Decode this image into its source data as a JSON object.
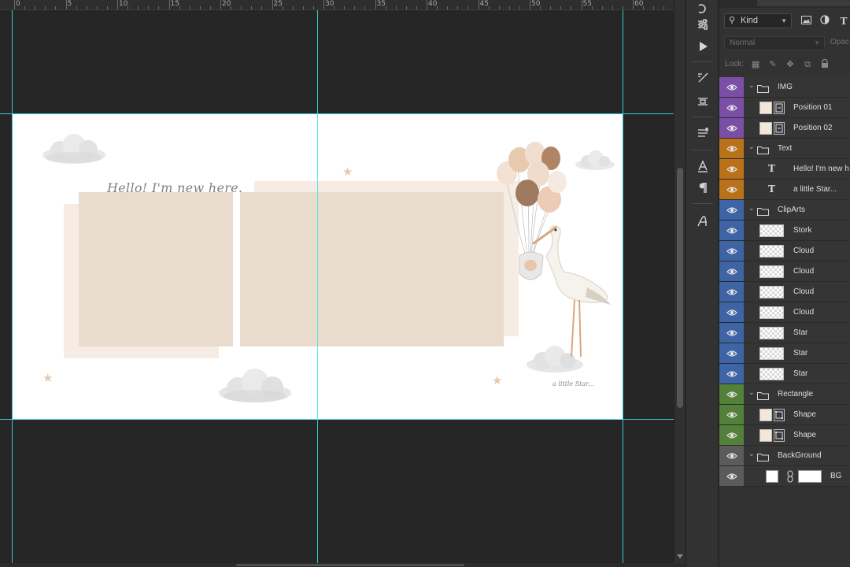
{
  "ruler": {
    "labels": [
      "0",
      "5",
      "10",
      "15",
      "20",
      "25",
      "30",
      "35",
      "40",
      "45",
      "50",
      "55",
      "60"
    ]
  },
  "canvas": {
    "hello_text": "Hello! I'm new here.",
    "little_star_text": "a little Star..."
  },
  "layers_panel": {
    "filter": {
      "kind_label": "Kind"
    },
    "blend_mode": "Normal",
    "opacity_label": "Opac",
    "lock_label": "Lock:",
    "layers": [
      {
        "name": "IMG",
        "kind": "group",
        "color": "#7b4fa6"
      },
      {
        "name": "Position 01",
        "kind": "smart",
        "color": "#7b4fa6"
      },
      {
        "name": "Position 02",
        "kind": "smart",
        "color": "#7b4fa6"
      },
      {
        "name": "Text",
        "kind": "group",
        "color": "#b9711a"
      },
      {
        "name": "Hello! I'm new h",
        "kind": "text",
        "color": "#b9711a"
      },
      {
        "name": "a little Star...",
        "kind": "text",
        "color": "#b9711a"
      },
      {
        "name": "ClipArts",
        "kind": "group",
        "color": "#3e64a6"
      },
      {
        "name": "Stork",
        "kind": "pixel",
        "color": "#3e64a6"
      },
      {
        "name": "Cloud",
        "kind": "pixel",
        "color": "#3e64a6"
      },
      {
        "name": "Cloud",
        "kind": "pixel",
        "color": "#3e64a6"
      },
      {
        "name": "Cloud",
        "kind": "pixel",
        "color": "#3e64a6"
      },
      {
        "name": "Cloud",
        "kind": "pixel",
        "color": "#3e64a6"
      },
      {
        "name": "Star",
        "kind": "pixel",
        "color": "#3e64a6"
      },
      {
        "name": "Star",
        "kind": "pixel",
        "color": "#3e64a6"
      },
      {
        "name": "Star",
        "kind": "pixel",
        "color": "#3e64a6"
      },
      {
        "name": "Rectangle",
        "kind": "group",
        "color": "#53803a"
      },
      {
        "name": "Shape",
        "kind": "shape",
        "color": "#53803a"
      },
      {
        "name": "Shape",
        "kind": "shape",
        "color": "#53803a"
      },
      {
        "name": "BackGround",
        "kind": "group",
        "color": "#5b5b5b"
      },
      {
        "name": "BG",
        "kind": "fill",
        "color": "#5b5b5b"
      }
    ]
  }
}
